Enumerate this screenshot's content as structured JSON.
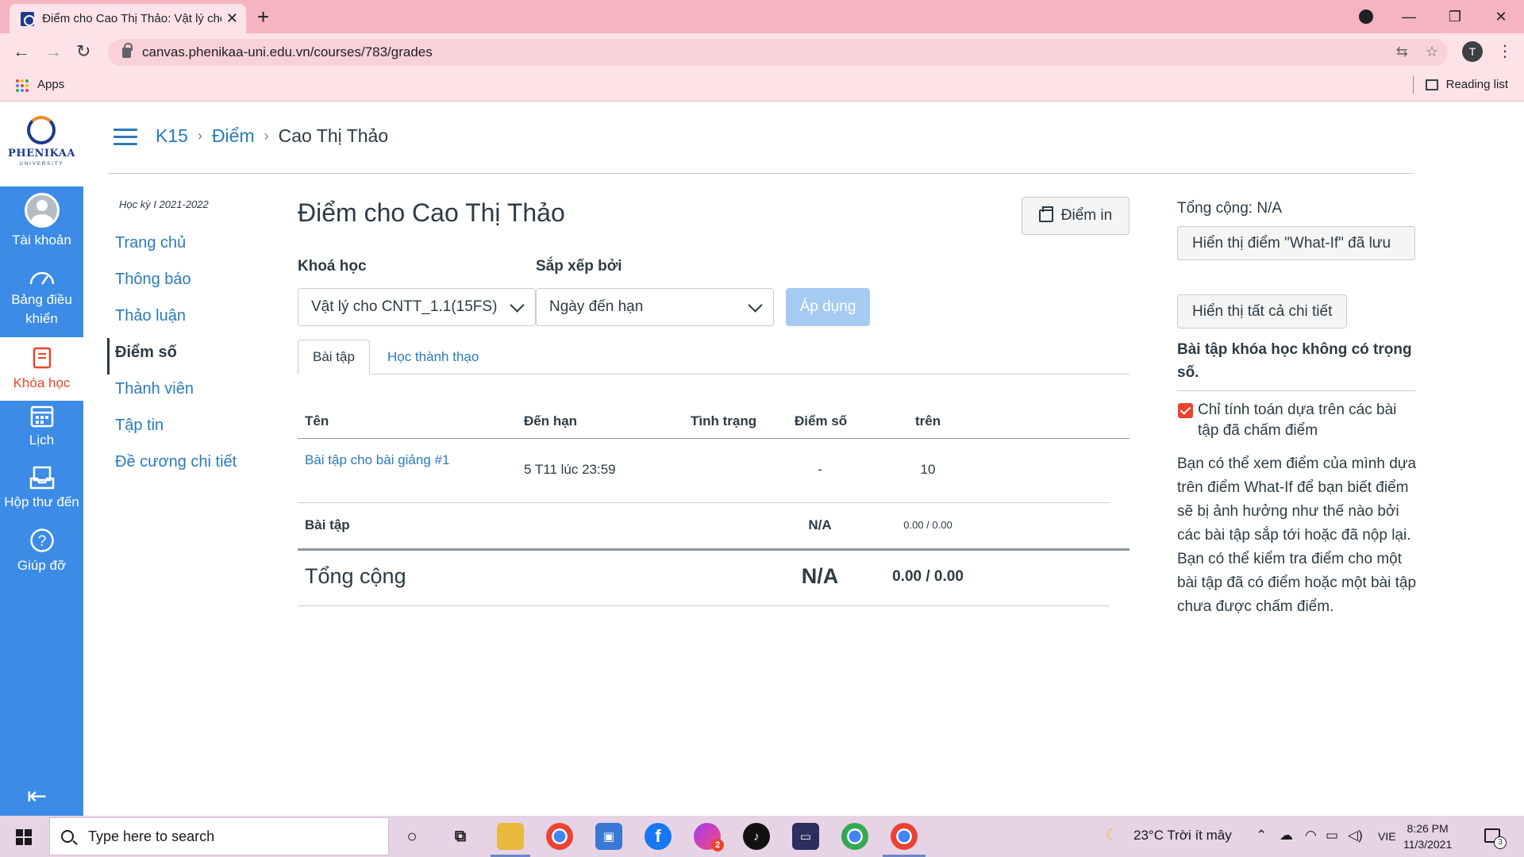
{
  "browser": {
    "tab_title": "Điểm cho Cao Thị Thảo: Vật lý cho",
    "url": "canvas.phenikaa-uni.edu.vn/courses/783/grades",
    "profile_initial": "T",
    "bookmarks_apps": "Apps",
    "reading_list": "Reading list"
  },
  "logo": {
    "name": "PHENIKAA",
    "sub": "UNIVERSITY"
  },
  "global_nav": [
    {
      "label": "Tài khoản"
    },
    {
      "label": "Bảng điều khiển"
    },
    {
      "label": "Khóa học"
    },
    {
      "label": "Lịch"
    },
    {
      "label": "Hộp thư đến"
    },
    {
      "label": "Giúp đỡ"
    }
  ],
  "breadcrumb": {
    "course": "K15",
    "section": "Điểm",
    "current": "Cao Thị Thảo"
  },
  "course_nav": {
    "term": "Học kỳ I 2021-2022",
    "items": [
      "Trang chủ",
      "Thông báo",
      "Thảo luận",
      "Điểm số",
      "Thành viên",
      "Tập tin",
      "Đề cương chi tiết"
    ]
  },
  "main": {
    "title": "Điểm cho Cao Thị Thảo",
    "print_label": "Điểm in",
    "course_label": "Khoá học",
    "course_value": "Vật lý cho CNTT_1.1(15FS)",
    "sort_label": "Sắp xếp bởi",
    "sort_value": "Ngày đến hạn",
    "apply_label": "Áp dụng",
    "tabs": [
      "Bài tập",
      "Học thành thạo"
    ],
    "columns": [
      "Tên",
      "Đến hạn",
      "Tình trạng",
      "Điểm số",
      "trên"
    ],
    "assignment": {
      "name": "Bài tập cho bài giảng #1",
      "due": "5 T11 lúc 23:59",
      "status": "",
      "score": "-",
      "out_of": "10"
    },
    "group": {
      "name": "Bài tập",
      "score": "N/A",
      "out_of": "0.00 / 0.00"
    },
    "total": {
      "name": "Tổng cộng",
      "score": "N/A",
      "out_of": "0.00 / 0.00"
    }
  },
  "sidebar": {
    "total": "Tổng cộng: N/A",
    "whatif_btn": "Hiển thị điểm \"What-If\" đã lưu",
    "details_btn": "Hiển thị tất cả chi tiết",
    "note": "Bài tập khóa học không có trọng số.",
    "checkbox_label": "Chỉ tính toán dựa trên các bài tập đã chấm điểm",
    "checkbox_checked": true,
    "paragraph": "Bạn có thể xem điểm của mình dựa trên điểm What-If để bạn biết điểm sẽ bị ảnh hưởng như thế nào bởi các bài tập sắp tới hoặc đã nộp lại. Bạn có thể kiểm tra điểm cho một bài tập đã có điểm hoặc một bài tập chưa được chấm điểm."
  },
  "taskbar": {
    "search_placeholder": "Type here to search",
    "weather": "23°C  Trời ít mây",
    "lang": "VIE",
    "time": "8:26 PM",
    "date": "11/3/2021",
    "messenger_badge": "2",
    "notif_count": "3"
  },
  "colors": {
    "canvas_blue": "#3c8be7",
    "link": "#2b7abc",
    "accent_red": "#e8452c",
    "chrome_pink": "#f6b3c0"
  }
}
